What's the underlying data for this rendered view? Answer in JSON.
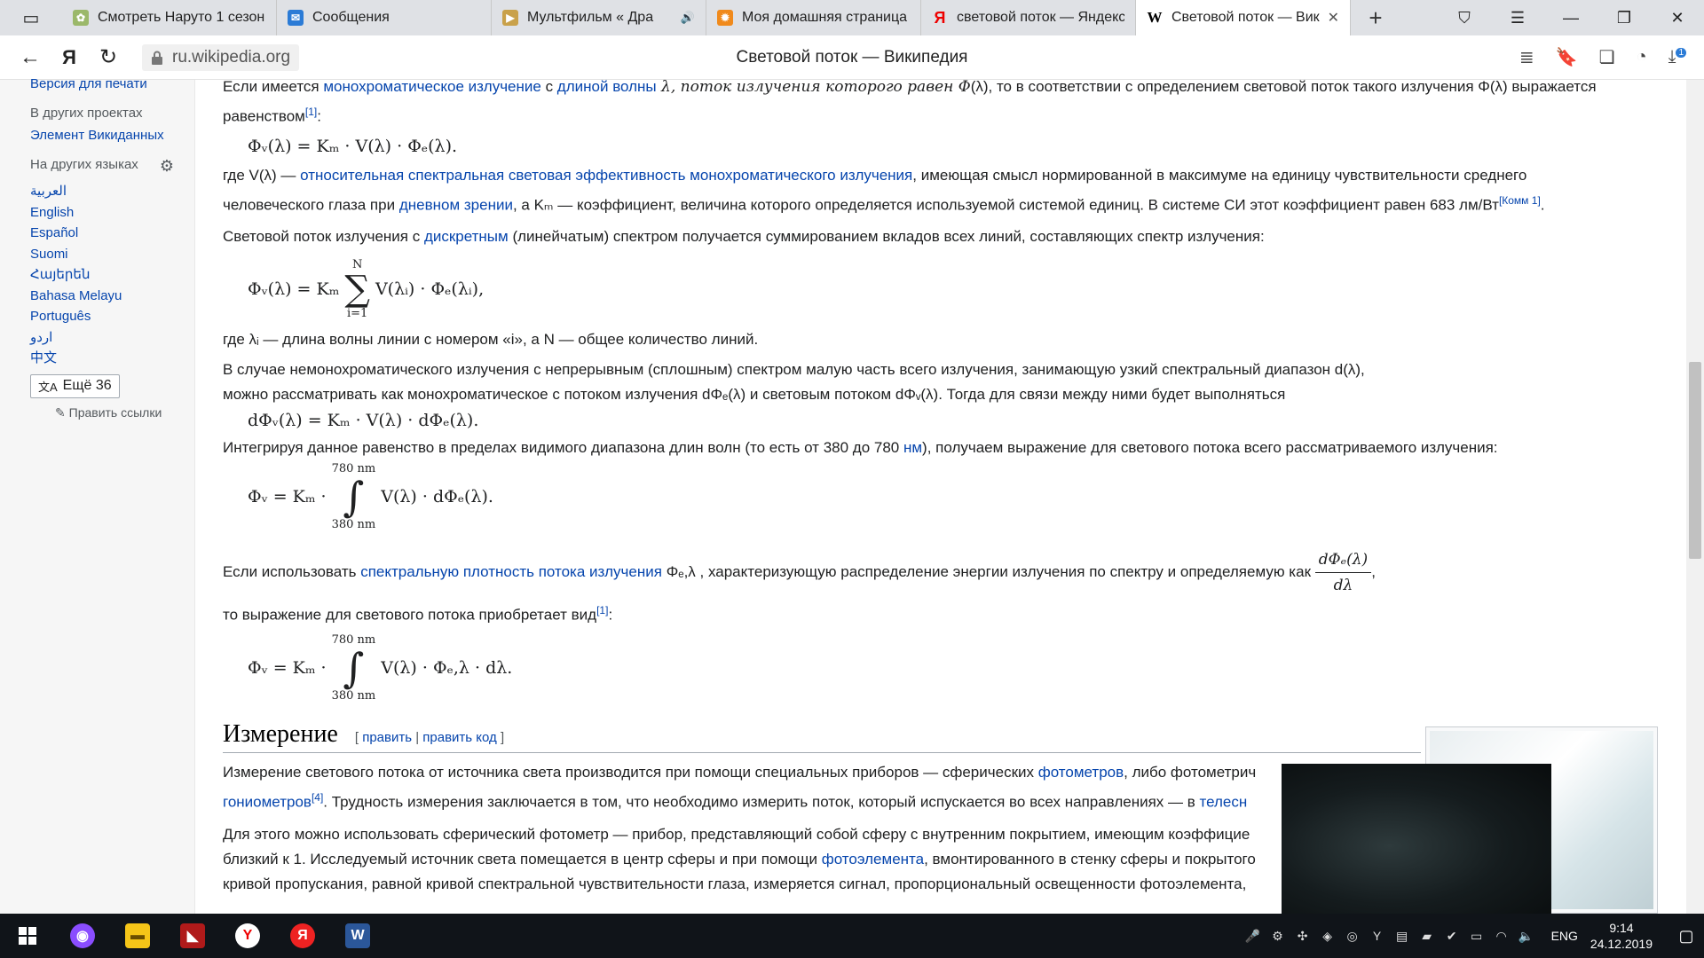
{
  "browser": {
    "tabs": [
      {
        "title": "Смотреть Наруто 1 сезон",
        "favicon_color": "#9bb86a",
        "glyph": "✿"
      },
      {
        "title": "Сообщения",
        "favicon_color": "#2b7bd6",
        "glyph": "✉"
      },
      {
        "title": "Мультфильм « Дра",
        "favicon_color": "#c9a14a",
        "glyph": "▶"
      },
      {
        "title": "Моя домашняя страница",
        "favicon_color": "#f08a1c",
        "glyph": "✹"
      },
      {
        "title": "световой поток — Яндекс",
        "favicon_color": "#ffffff",
        "glyph": "Я"
      },
      {
        "title": "Световой поток — Вик",
        "favicon_color": "#ffffff",
        "glyph": "W"
      }
    ],
    "url": "ru.wikipedia.org",
    "page_title": "Световой поток — Википедия",
    "nav_logo": "Я",
    "download_badge": "1"
  },
  "sidebar": {
    "print_version": "Версия для печати",
    "other_projects_head": "В других проектах",
    "wikidata": "Элемент Викиданных",
    "languages_head": "На других языках",
    "languages": [
      "العربية",
      "English",
      "Español",
      "Suomi",
      "Հայերեն",
      "Bahasa Melayu",
      "Português",
      "اردو",
      "中文"
    ],
    "more_languages": "Ещё 36",
    "edit_links": "Править ссылки"
  },
  "article": {
    "p1_a": "Если имеется ",
    "p1_link1": "монохроматическое излучение",
    "p1_b": " с ",
    "p1_link2": "длиной волны",
    "p1_c": " λ, поток излучения которого равен Φ",
    "p1_d": "(λ), то в соответствии с определением световой поток такого излучения Φ",
    "p1_e": "(λ) выражается равенством",
    "ref1": "[1]",
    "f1": "Φᵥ(λ) = Kₘ · V(λ) · Φₑ(λ).",
    "p2_a": "где V(λ) — ",
    "p2_link1": "относительная спектральная световая эффективность монохроматического излучения",
    "p2_b": ", имеющая смысл нормированной в максимуме на единицу чувствительности среднего человеческого глаза при ",
    "p2_link2": "дневном зрении",
    "p2_c": ", а Kₘ — коэффициент, величина которого определяется используемой системой единиц. В системе СИ этот коэффициент равен 683 лм/Вт",
    "note1": "[Комм 1]",
    "p3_a": "Световой поток излучения с ",
    "p3_link": "дискретным",
    "p3_b": " (линейчатым) спектром получается суммированием вкладов всех линий, составляющих спектр излучения:",
    "f2_left": "Φᵥ(λ) = Kₘ",
    "f2_top": "N",
    "f2_bottom": "i=1",
    "f2_right": "V(λᵢ) · Φₑ(λᵢ),",
    "p4": "где λᵢ — длина волны линии с номером «i», а N — общее количество линий.",
    "p5_a": "В случае немонохроматического излучения с непрерывным (сплошным) спектром малую часть всего излучения, занимающую узкий спектральный диапазон d(λ), можно рассматривать как монохроматическое с потоком излучения dΦₑ(λ) и световым потоком dΦᵥ(λ). Тогда для связи между ними будет выполняться",
    "f3": "dΦᵥ(λ) = Kₘ · V(λ) · dΦₑ(λ).",
    "p6_a": "Интегрируя данное равенство в пределах видимого диапазона длин волн (то есть от 380 до 780 ",
    "p6_link": "нм",
    "p6_b": "), получаем выражение для светового потока всего рассматриваемого излучения:",
    "f4_left": "Φᵥ = Kₘ ·",
    "int_top": "780 nm",
    "int_bottom": "380 nm",
    "f4_right": "V(λ) · dΦₑ(λ).",
    "p7_a": "Если использовать ",
    "p7_link": "спектральную плотность потока излучения",
    "p7_b": " Φₑ,λ , характеризующую распределение энергии излучения по спектру и определяемую как ",
    "frac_num": "dΦₑ(λ)",
    "frac_den": "dλ",
    "p7_c": ", то выражение для светового потока приобретает вид",
    "ref2": "[1]",
    "f5_right": "V(λ) · Φₑ,λ · dλ.",
    "section_title": "Измерение",
    "edit": "править",
    "edit_code": "править код",
    "p8_a": "Измерение светового потока от источника света производится при помощи специальных приборов — сферических ",
    "p8_link1": "фотометров",
    "p8_b": ", либо фотометрич",
    "p8_link2": "гониометров",
    "ref4": "[4]",
    "p8_c": ". Трудность измерения заключается в том, что необходимо измерить поток, который испускается во всех направлениях — в ",
    "p8_link3": "телесн",
    "p9_a": "Для этого можно использовать сферический фотометр — прибор, представляющий собой сферу с внутренним покрытием, имеющим коэффицие",
    "p9_b": "близкий к 1. Исследуемый источник света помещается в центр сферы и при помощи ",
    "p9_link": "фотоэлемента",
    "p9_c": ", вмонтированного в стенку сферы и покрытого",
    "p9_d": "кривой пропускания, равной кривой спектральной чувствительности глаза, измеряется сигнал, пропорциональный освещенности фотоэлемента,"
  },
  "taskbar": {
    "lang": "ENG",
    "time": "9:14",
    "date": "24.12.2019"
  }
}
